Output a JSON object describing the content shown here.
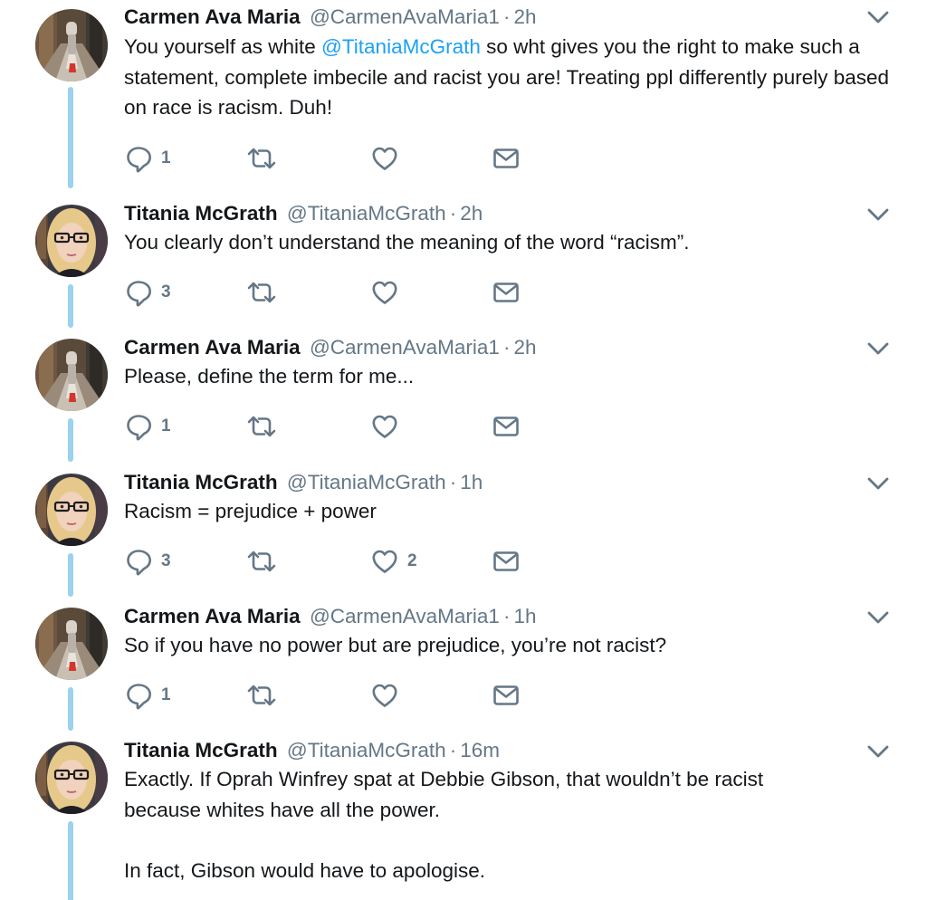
{
  "tweets": [
    {
      "author_name": "Carmen Ava Maria",
      "handle": "@CarmenAvaMaria1",
      "separator": "·",
      "time": "2h",
      "text_before": "You yourself as white ",
      "mention": "@TitaniaMcGrath",
      "text_after": " so wht gives you the right to make such a statement, complete imbecile and racist you are! Treating ppl differently purely based on race is racism. Duh!",
      "reply_count": "1",
      "retweet_count": "",
      "like_count": ""
    },
    {
      "author_name": "Titania McGrath",
      "handle": "@TitaniaMcGrath",
      "separator": "·",
      "time": "2h",
      "text": "You clearly don’t understand the meaning of the word “racism”.",
      "reply_count": "3",
      "retweet_count": "",
      "like_count": ""
    },
    {
      "author_name": "Carmen Ava Maria",
      "handle": "@CarmenAvaMaria1",
      "separator": "·",
      "time": "2h",
      "text": "Please, define the term for me...",
      "reply_count": "1",
      "retweet_count": "",
      "like_count": ""
    },
    {
      "author_name": "Titania McGrath",
      "handle": "@TitaniaMcGrath",
      "separator": "·",
      "time": "1h",
      "text": "Racism = prejudice + power",
      "reply_count": "3",
      "retweet_count": "",
      "like_count": "2"
    },
    {
      "author_name": "Carmen Ava Maria",
      "handle": "@CarmenAvaMaria1",
      "separator": "·",
      "time": "1h",
      "text": "So if you have no power but are prejudice, you’re not racist?",
      "reply_count": "1",
      "retweet_count": "",
      "like_count": ""
    },
    {
      "author_name": "Titania McGrath",
      "handle": "@TitaniaMcGrath",
      "separator": "·",
      "time": "16m",
      "text_p1": "Exactly. If Oprah Winfrey spat at Debbie Gibson, that wouldn’t be racist because whites have all the power.",
      "text_p2": "In fact, Gibson would have to apologise."
    }
  ],
  "icons": {
    "reply": "reply-icon",
    "retweet": "retweet-icon",
    "like": "heart-icon",
    "message": "envelope-icon",
    "more": "chevron-down-icon"
  },
  "colors": {
    "text": "#14171a",
    "secondary": "#657786",
    "link": "#1da1f2",
    "thread_line": "#9ad2f0"
  }
}
